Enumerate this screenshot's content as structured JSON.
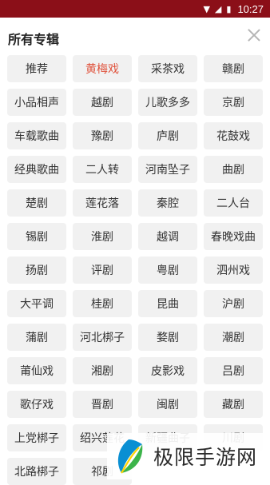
{
  "status_bar": {
    "time": "10:27",
    "icons": [
      "wifi-icon",
      "signal-icon",
      "battery-icon"
    ]
  },
  "header": {
    "title": "所有专辑",
    "close_icon": "close-icon"
  },
  "colors": {
    "status_bar_bg": "#8b0f18",
    "chip_bg": "#f1f1f1",
    "active_text": "#e0533d",
    "text": "#333333"
  },
  "albums": [
    {
      "label": "推荐"
    },
    {
      "label": "黄梅戏",
      "active": true
    },
    {
      "label": "采茶戏"
    },
    {
      "label": "赣剧"
    },
    {
      "label": "小品相声"
    },
    {
      "label": "越剧"
    },
    {
      "label": "儿歌多多"
    },
    {
      "label": "京剧"
    },
    {
      "label": "车载歌曲"
    },
    {
      "label": "豫剧"
    },
    {
      "label": "庐剧"
    },
    {
      "label": "花鼓戏"
    },
    {
      "label": "经典歌曲"
    },
    {
      "label": "二人转"
    },
    {
      "label": "河南坠子"
    },
    {
      "label": "曲剧"
    },
    {
      "label": "楚剧"
    },
    {
      "label": "莲花落"
    },
    {
      "label": "秦腔"
    },
    {
      "label": "二人台"
    },
    {
      "label": "锡剧"
    },
    {
      "label": "淮剧"
    },
    {
      "label": "越调"
    },
    {
      "label": "春晚戏曲"
    },
    {
      "label": "扬剧"
    },
    {
      "label": "评剧"
    },
    {
      "label": "粤剧"
    },
    {
      "label": "泗州戏"
    },
    {
      "label": "大平调"
    },
    {
      "label": "桂剧"
    },
    {
      "label": "昆曲"
    },
    {
      "label": "沪剧"
    },
    {
      "label": "蒲剧"
    },
    {
      "label": "河北梆子"
    },
    {
      "label": "婺剧"
    },
    {
      "label": "潮剧"
    },
    {
      "label": "莆仙戏"
    },
    {
      "label": "湘剧"
    },
    {
      "label": "皮影戏"
    },
    {
      "label": "吕剧"
    },
    {
      "label": "歌仔戏"
    },
    {
      "label": "晋剧"
    },
    {
      "label": "闽剧"
    },
    {
      "label": "藏剧"
    },
    {
      "label": "上党梆子"
    },
    {
      "label": "绍兴莲花"
    },
    {
      "label": "新疆曲子"
    },
    {
      "label": "川剧"
    },
    {
      "label": "北路梆子"
    },
    {
      "label": "祁剧"
    }
  ],
  "watermark": {
    "text": "极限手游网",
    "logo_icon": "leaf-logo-icon"
  }
}
